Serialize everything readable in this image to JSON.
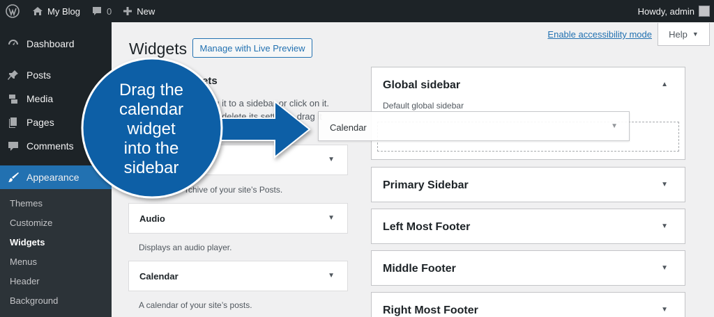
{
  "adminbar": {
    "site_name": "My Blog",
    "comments_count": "0",
    "new_label": "New",
    "howdy": "Howdy, admin"
  },
  "menu": {
    "dashboard": "Dashboard",
    "posts": "Posts",
    "media": "Media",
    "pages": "Pages",
    "comments": "Comments",
    "appearance": "Appearance",
    "submenu": [
      "Themes",
      "Customize",
      "Widgets",
      "Menus",
      "Header",
      "Background"
    ]
  },
  "screen_links": {
    "accessibility": "Enable accessibility mode",
    "help": "Help"
  },
  "page": {
    "title": "Widgets",
    "live_preview": "Manage with Live Preview",
    "available_title_visible": "ets",
    "available_desc_line1": "ag it to a sidebar or click on it.",
    "available_desc_line2": "nd delete its settings, drag it"
  },
  "widgets": [
    {
      "name": "",
      "desc": "rchive of your site’s Posts."
    },
    {
      "name": "Audio",
      "desc": "Displays an audio player."
    },
    {
      "name": "Calendar",
      "desc": "A calendar of your site’s posts."
    }
  ],
  "sidebars": [
    {
      "title": "Global sidebar",
      "desc": "Default global sidebar",
      "open": true
    },
    {
      "title": "Primary Sidebar"
    },
    {
      "title": "Left Most Footer"
    },
    {
      "title": "Middle Footer"
    },
    {
      "title": "Right Most Footer"
    }
  ],
  "dragging_widget": {
    "label": "Calendar"
  },
  "callout": {
    "lines": [
      "Drag the",
      "calendar",
      "widget",
      "into the",
      "sidebar"
    ],
    "color": "#0e5fa6"
  },
  "colors": {
    "adminbar": "#1d2327",
    "accent": "#2271b1",
    "background": "#f0f0f1"
  }
}
